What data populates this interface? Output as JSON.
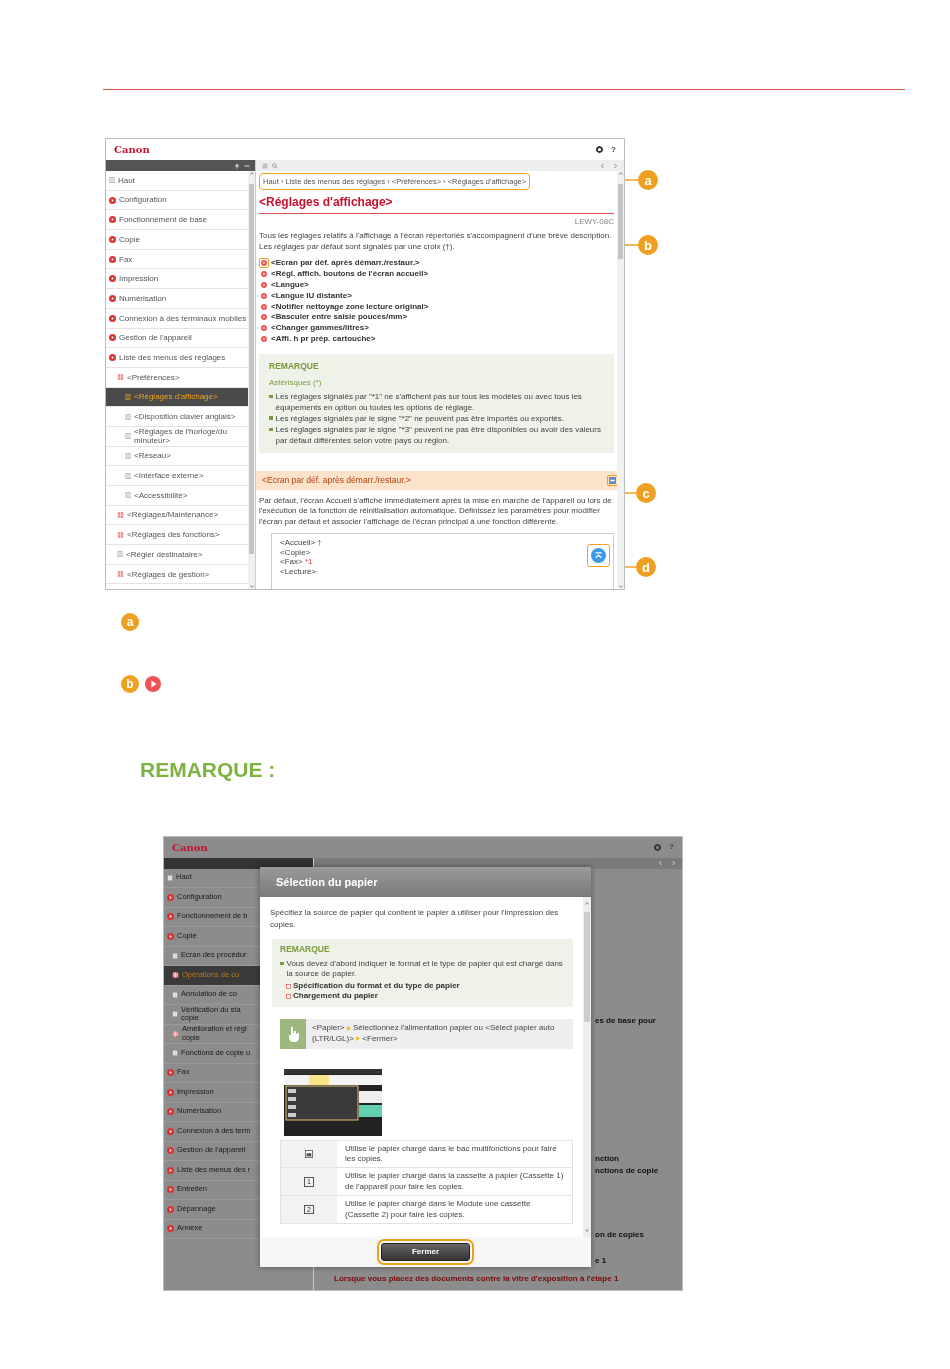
{
  "top_screenshot": {
    "logo": "Canon",
    "help_glyph": "?",
    "sidebar": [
      {
        "label": "Haut",
        "kind": "page",
        "selected": false
      },
      {
        "label": "Configuration",
        "kind": "chapter",
        "selected": false
      },
      {
        "label": "Fonctionnement de base",
        "kind": "chapter",
        "selected": false
      },
      {
        "label": "Copie",
        "kind": "chapter",
        "selected": false
      },
      {
        "label": "Fax",
        "kind": "chapter",
        "selected": false
      },
      {
        "label": "Impression",
        "kind": "chapter",
        "selected": false
      },
      {
        "label": "Numérisation",
        "kind": "chapter",
        "selected": false
      },
      {
        "label": "Connexion à des terminaux mobiles",
        "kind": "chapter",
        "selected": false
      },
      {
        "label": "Gestion de l'appareil",
        "kind": "chapter",
        "selected": false
      },
      {
        "label": "Liste des menus des réglages",
        "kind": "chapter",
        "selected": false,
        "children": [
          {
            "label": "<Préférences>",
            "kind": "section",
            "selected": false,
            "children": [
              {
                "label": "<Réglages d'affichage>",
                "kind": "page",
                "selected": true
              },
              {
                "label": "<Disposition clavier anglais>",
                "kind": "page",
                "selected": false
              },
              {
                "label": "<Réglages de l'horloge/du minuteur>",
                "kind": "page",
                "selected": false
              },
              {
                "label": "<Réseau>",
                "kind": "page",
                "selected": false
              },
              {
                "label": "<Interface externe>",
                "kind": "page",
                "selected": false
              },
              {
                "label": "<Accessibilité>",
                "kind": "page",
                "selected": false
              }
            ]
          },
          {
            "label": "<Réglages/Maintenance>",
            "kind": "section",
            "selected": false
          },
          {
            "label": "<Réglages des fonctions>",
            "kind": "section",
            "selected": false
          },
          {
            "label": "<Régler destinataire>",
            "kind": "page",
            "selected": false
          },
          {
            "label": "<Réglages de gestion>",
            "kind": "section",
            "selected": false
          }
        ]
      }
    ],
    "breadcrumb": "Haut › Liste des menus des réglages › <Préférences> › <Réglages d'affichage>",
    "title": "<Réglages d'affichage>",
    "doc_id": "LEWY-08C",
    "intro": "Tous les réglages relatifs à l'affichage à l'écran répertoriés s'accompagnent d'une brève description. Les réglages par défaut sont signalés par une croix (†).",
    "links": [
      {
        "label": "<Ecran par déf. après démarr./restaur.>",
        "outlined": true
      },
      {
        "label": "<Régl. affich. boutons de l'écran accueil>",
        "outlined": false
      },
      {
        "label": "<Langue>",
        "outlined": false
      },
      {
        "label": "<Langue IU distante>",
        "outlined": false
      },
      {
        "label": "<Notifier nettoyage zone lecture original>",
        "outlined": false
      },
      {
        "label": "<Basculer entre saisie pouces/mm>",
        "outlined": false
      },
      {
        "label": "<Changer gammes/litres>",
        "outlined": false
      },
      {
        "label": "<Affi. h pr prép. cartouche>",
        "outlined": false
      }
    ],
    "note": {
      "title": "REMARQUE",
      "subtitle": "Astérisques (*)",
      "items": [
        "Les réglages signalés par \"*1\" ne s'affichent pas sur tous les modèles ou avec tous les équipements en option ou toutes les options de réglage.",
        "Les réglages signalés par le signe \"*2\" ne peuvent pas être importés ou exportés.",
        "Les réglages signalés par le signe \"*3\" peuvent ne pas être disponibles ou avoir des valeurs par défaut différentes selon votre pays ou région."
      ]
    },
    "section_heading": "<Ecran par déf. après démarr./restaur.>",
    "section_text": "Par défaut, l'écran Accueil s'affiche immédiatement après la mise en marche de l'appareil ou lors de l'exécution de la fonction de réinitialisation automatique. Définissez les paramètres pour modifier l'écran par défaut et associer l'affichage de l'écran principal à une fonction différente.",
    "code_lines": [
      {
        "text": "<Accueil>",
        "mark": "†"
      },
      {
        "text": "<Copie>"
      },
      {
        "text": "<Fax>",
        "mark": "*1"
      },
      {
        "text": "<Lecture>"
      }
    ]
  },
  "callouts": [
    {
      "letter": "a"
    },
    {
      "letter": "b"
    },
    {
      "letter": "c"
    },
    {
      "letter": "d"
    }
  ],
  "legend": [
    {
      "letters": [
        "a"
      ],
      "play_icon": false
    },
    {
      "letters": [
        "b"
      ],
      "play_icon": true
    }
  ],
  "remarque_heading": "REMARQUE :",
  "bottom_screenshot": {
    "logo": "Canon",
    "help_glyph": "?",
    "sidebar": [
      {
        "label": "Haut",
        "kind": "page",
        "selected": false
      },
      {
        "label": "Configuration",
        "kind": "chapter",
        "selected": false
      },
      {
        "label": "Fonctionnement de b",
        "kind": "chapter",
        "selected": false
      },
      {
        "label": "Copie",
        "kind": "chapter",
        "selected": false,
        "children": [
          {
            "label": "Ecran des procédur",
            "kind": "page",
            "selected": false
          },
          {
            "label": "Opérations de co",
            "kind": "section",
            "selected": true
          },
          {
            "label": "Annulation de co",
            "kind": "page",
            "selected": false
          },
          {
            "label": "Vérification du sta\ncopie",
            "kind": "page",
            "selected": false
          },
          {
            "label": "Amélioration et régl\ncopie",
            "kind": "section",
            "selected": false
          },
          {
            "label": "Fonctions de copie u",
            "kind": "page",
            "selected": false
          }
        ]
      },
      {
        "label": "Fax",
        "kind": "chapter",
        "selected": false
      },
      {
        "label": "Impression",
        "kind": "chapter",
        "selected": false
      },
      {
        "label": "Numérisation",
        "kind": "chapter",
        "selected": false
      },
      {
        "label": "Connexion à des term",
        "kind": "chapter",
        "selected": false
      },
      {
        "label": "Gestion de l'appareil",
        "kind": "chapter",
        "selected": false
      },
      {
        "label": "Liste des menus des r",
        "kind": "chapter",
        "selected": false
      },
      {
        "label": "Entretien",
        "kind": "chapter",
        "selected": false
      },
      {
        "label": "Dépannage",
        "kind": "chapter",
        "selected": false
      },
      {
        "label": "Annexe",
        "kind": "chapter",
        "selected": false
      }
    ],
    "background_texts": [
      "es de base pour",
      "nction",
      "nctions de copie",
      "on de copies",
      "e 1"
    ],
    "background_link": "Lorsque vous placez des documents contre la vitre d'exposition à l'étape 1",
    "dialog": {
      "title": "Sélection du papier",
      "intro": "Spécifiez la source de papier qui contient le papier à utiliser pour l'impression des copies.",
      "note": {
        "title": "REMARQUE",
        "text": "Vous devez d'abord indiquer le format et le type de papier qui est chargé dans la source de papier.",
        "links": [
          "Spécification du format et du type de papier",
          "Chargement du papier"
        ]
      },
      "step": [
        "<Papier>",
        "Sélectionnez l'alimentation papier ou <Sélect papier auto (LTR/LGL)>",
        "<Fermer>"
      ],
      "rows": [
        {
          "kind": "tray",
          "text": "Utilise le papier chargé dans le bac multifonctions pour faire les copies."
        },
        {
          "kind": "number",
          "number": "1",
          "text": "Utilise le papier chargé dans la cassette à papier (Cassette 1) de l'appareil pour faire les copies."
        },
        {
          "kind": "number",
          "number": "2",
          "text": "Utilise le papier chargé dans le Module une cassette (Cassette 2) pour faire les copies."
        }
      ],
      "button": "Fermer"
    }
  }
}
